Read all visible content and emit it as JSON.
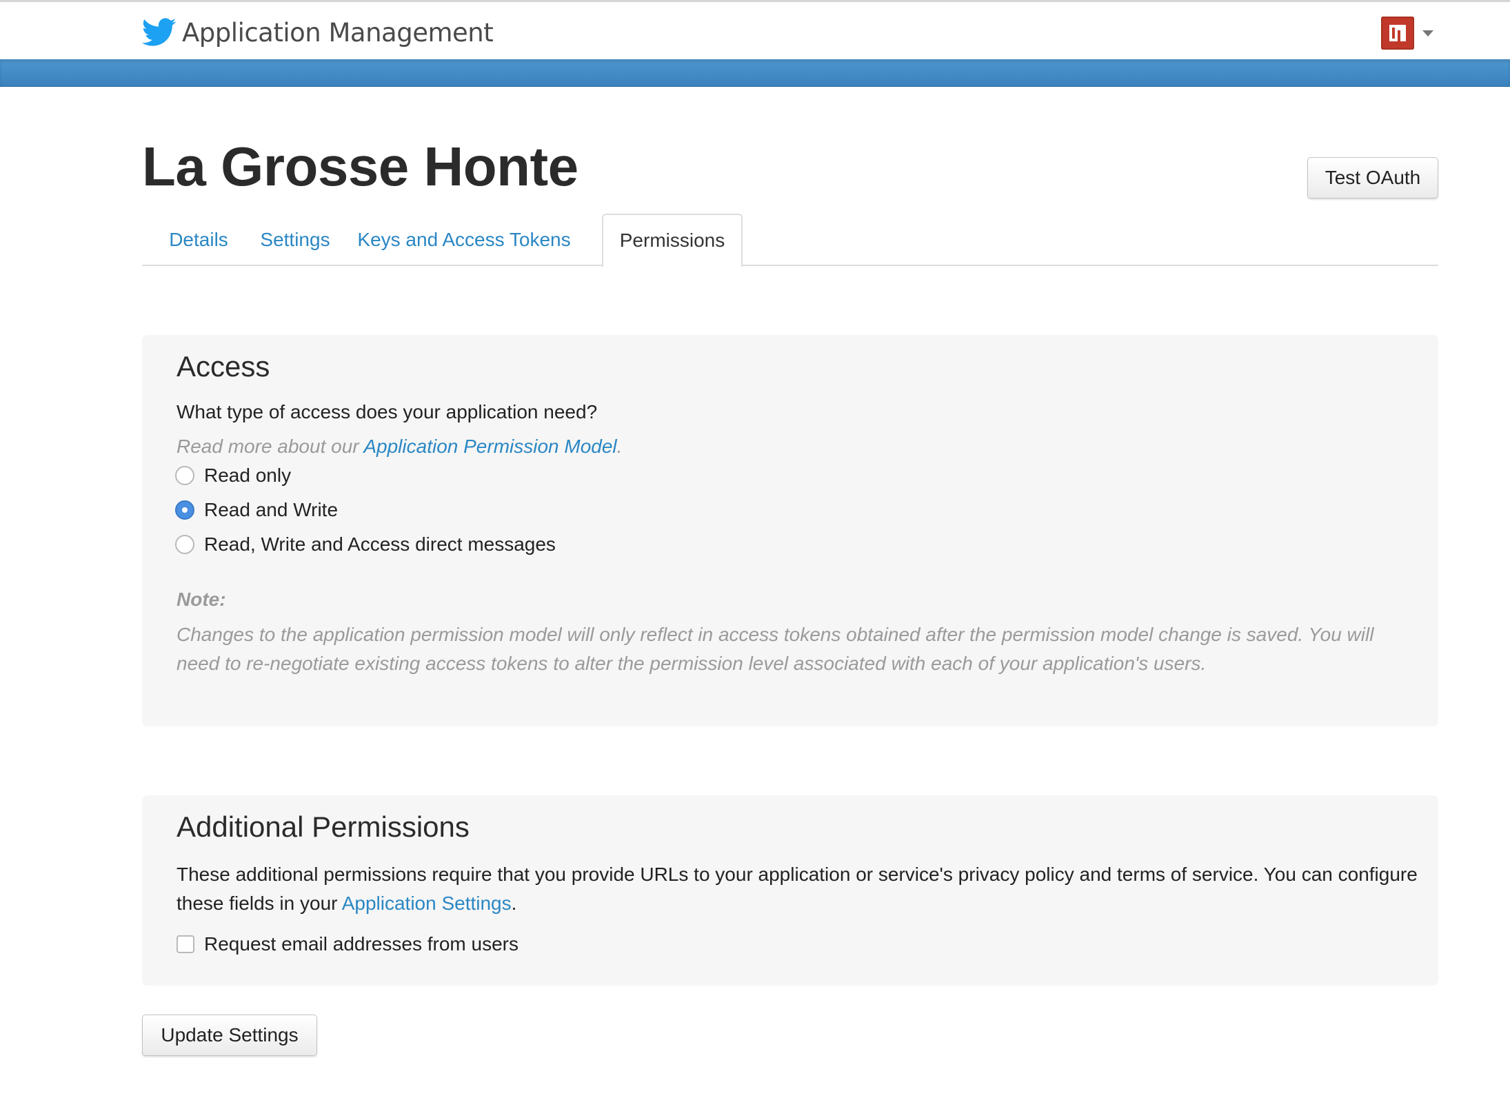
{
  "header": {
    "app_title": "Application Management",
    "brand_icon": "twitter-bird-icon",
    "brand_color": "#1da1f2",
    "band_color": "#3f8bc6"
  },
  "page": {
    "title": "La Grosse Honte",
    "test_oauth_label": "Test OAuth"
  },
  "tabs": [
    {
      "label": "Details",
      "active": false
    },
    {
      "label": "Settings",
      "active": false
    },
    {
      "label": "Keys and Access Tokens",
      "active": false
    },
    {
      "label": "Permissions",
      "active": true
    }
  ],
  "access": {
    "heading": "Access",
    "question": "What type of access does your application need?",
    "readmore_prefix": "Read more about our ",
    "readmore_link": "Application Permission Model",
    "readmore_suffix": ".",
    "options": [
      {
        "label": "Read only",
        "checked": false
      },
      {
        "label": "Read and Write",
        "checked": true
      },
      {
        "label": "Read, Write and Access direct messages",
        "checked": false
      }
    ],
    "note_label": "Note:",
    "note_text": "Changes to the application permission model will only reflect in access tokens obtained after the permission model change is saved. You will need to re-negotiate existing access tokens to alter the permission level associated with each of your application's users."
  },
  "additional": {
    "heading": "Additional Permissions",
    "text_prefix": "These additional permissions require that you provide URLs to your application or service's privacy policy and terms of service. You can configure these fields in your ",
    "text_link": "Application Settings",
    "text_suffix": ".",
    "email_checkbox_label": "Request email addresses from users",
    "email_checked": false
  },
  "footer": {
    "update_label": "Update Settings"
  }
}
